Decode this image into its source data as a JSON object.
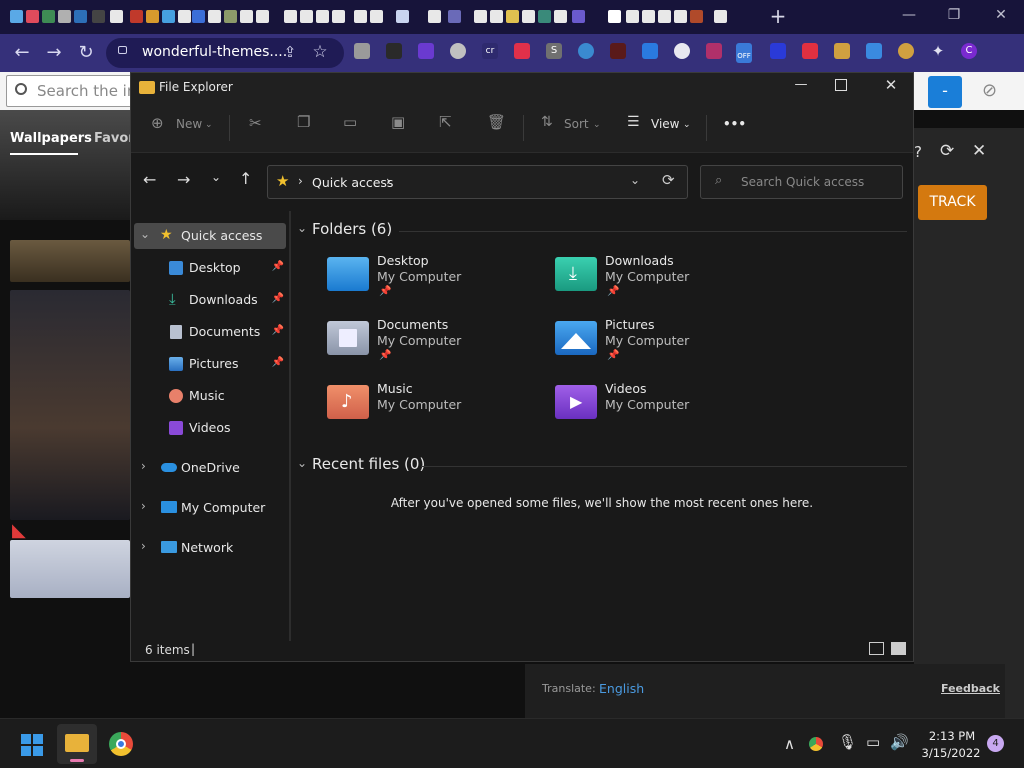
{
  "browser": {
    "url": "wonderful-themes....",
    "new_tab_label": "+",
    "window_controls": {
      "minimize": "—",
      "restore": "❐",
      "close": "✕"
    }
  },
  "page": {
    "search_placeholder": "Search the in",
    "tabs": [
      "Wallpapers",
      "Favor"
    ],
    "track_button": "TRACK",
    "translate_label": "Translate:",
    "translate_language": "English",
    "feedback_link": "Feedback",
    "extension_badge": "OFF",
    "profile_initial": "C"
  },
  "explorer": {
    "title": "File Explorer",
    "toolbar": {
      "new_label": "New",
      "sort_label": "Sort",
      "view_label": "View",
      "more_label": "•••"
    },
    "address": {
      "location": "Quick access",
      "separator": "›",
      "search_placeholder": "Search Quick access"
    },
    "nav": {
      "quick_access": "Quick access",
      "pinned": [
        {
          "label": "Desktop",
          "pinned": true
        },
        {
          "label": "Downloads",
          "pinned": true
        },
        {
          "label": "Documents",
          "pinned": true
        },
        {
          "label": "Pictures",
          "pinned": true
        },
        {
          "label": "Music",
          "pinned": false
        },
        {
          "label": "Videos",
          "pinned": false
        }
      ],
      "roots": [
        "OneDrive",
        "My Computer",
        "Network"
      ]
    },
    "folders_header": "Folders (6)",
    "folders": [
      {
        "name": "Desktop",
        "location": "My Computer",
        "pinned": true
      },
      {
        "name": "Downloads",
        "location": "My Computer",
        "pinned": true
      },
      {
        "name": "Documents",
        "location": "My Computer",
        "pinned": true
      },
      {
        "name": "Pictures",
        "location": "My Computer",
        "pinned": true
      },
      {
        "name": "Music",
        "location": "My Computer",
        "pinned": false
      },
      {
        "name": "Videos",
        "location": "My Computer",
        "pinned": false
      }
    ],
    "recent_header": "Recent files (0)",
    "recent_empty": "After you've opened some files, we'll show the most recent ones here.",
    "status_items": "6 items",
    "status_cursor": "|"
  },
  "taskbar": {
    "time": "2:13 PM",
    "date": "3/15/2022",
    "notification_count": "4"
  },
  "colors": {
    "tabstrip": "#17143a",
    "toolbar": "#35307a",
    "explorer_bg": "#191919",
    "accent": "#4ca0e0",
    "track_button": "#d4790f"
  }
}
